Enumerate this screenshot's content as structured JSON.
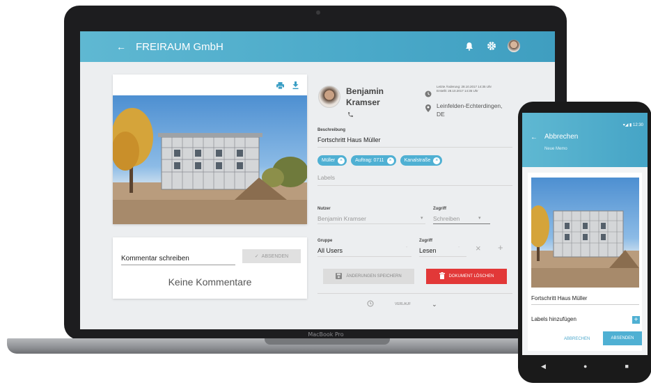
{
  "laptop": {
    "brand": "MacBook Pro",
    "appbar": {
      "back_icon": "arrow-left-icon",
      "title": "FREIRAUM GmbH",
      "icons": [
        "bell-icon",
        "gear-icon",
        "avatar"
      ]
    },
    "image_card": {
      "tools": [
        "print-icon",
        "download-icon"
      ]
    },
    "comments": {
      "placeholder": "Kommentar schreiben",
      "send_label": "ABSENDEN",
      "empty_text": "Keine Kommentare"
    },
    "person": {
      "first_name": "Benjamin",
      "last_name": "Kramser"
    },
    "meta": {
      "last_change": "Letzte Änderung: 28.10.2017 14:35 Uhr",
      "created": "Erstellt: 28.10.2017 14:35 Uhr",
      "location_line1": "Leinfelden-Echterdingen,",
      "location_line2": "DE"
    },
    "description": {
      "label": "Beschreibung",
      "value": "Fortschritt Haus Müller"
    },
    "chips": [
      "Müller",
      "Auftrag: 0711",
      "Kanalstraße"
    ],
    "labels_placeholder": "Labels",
    "user_row": {
      "user_label": "Nutzer",
      "user_value": "Benjamin Kramser",
      "access_label": "Zugriff",
      "access_value": "Schreiben"
    },
    "group_row": {
      "group_label": "Gruppe",
      "group_value": "All Users",
      "access_label": "Zugriff",
      "access_value": "Lesen"
    },
    "buttons": {
      "save": "ÄNDERUNGEN SPEICHERN",
      "delete": "DOKUMENT LÖSCHEN"
    },
    "history_label": "VERLAUF"
  },
  "phone": {
    "status_time": "12:30",
    "back_label": "Abbrechen",
    "subtitle": "Neue Memo",
    "description": "Fortschritt Haus Müller",
    "labels_add": "Labels hinzufügen",
    "cancel": "ABBRECHEN",
    "send": "ABSENDEN"
  },
  "colors": {
    "accent": "#4fb0d3",
    "danger": "#e23838"
  }
}
